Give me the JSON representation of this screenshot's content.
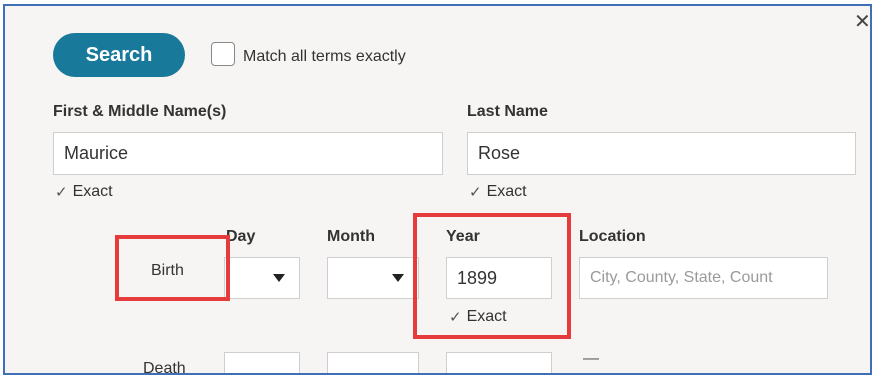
{
  "search_button": "Search",
  "match_all_label": "Match all terms exactly",
  "first_name": {
    "label": "First & Middle Name(s)",
    "value": "Maurice",
    "exact": "Exact"
  },
  "last_name": {
    "label": "Last Name",
    "value": "Rose",
    "exact": "Exact"
  },
  "columns": {
    "day": "Day",
    "month": "Month",
    "year": "Year",
    "location": "Location"
  },
  "birth": {
    "label": "Birth",
    "year": "1899",
    "year_exact": "Exact",
    "location_placeholder": "City, County, State, Count"
  },
  "death": {
    "label": "Death",
    "dash": "—"
  },
  "icons": {
    "close": "close-icon",
    "check": "check-icon",
    "dropdown": "chevron-down-icon"
  },
  "colors": {
    "primary": "#19799b",
    "highlight": "#e63b3b",
    "frame": "#3f6fb5"
  }
}
